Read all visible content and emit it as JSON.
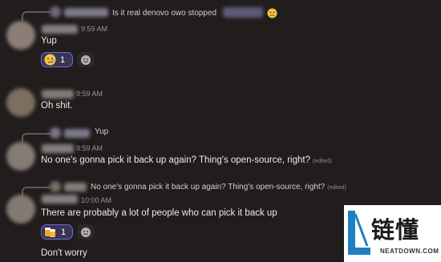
{
  "messages": [
    {
      "reply_preview": "Is it real denovo owo stopped",
      "time": "9:59 AM",
      "text": "Yup",
      "reactions": [
        {
          "emoji": "crying-face",
          "count": "1"
        }
      ]
    },
    {
      "time": "9:59 AM",
      "text": "Oh shit."
    },
    {
      "reply_preview": "Yup",
      "time": "9:59 AM",
      "text": "No one's gonna pick it back up again? Thing's open-source, right?",
      "edited": "(edited)"
    },
    {
      "reply_preview": "No one's gonna pick it back up again? Thing's open-source, right?",
      "reply_edited": "(edited)",
      "time": "10:00 AM",
      "text": "There are probably a lot of people who can pick it back up",
      "reactions": [
        {
          "emoji": "beer-mugs",
          "count": "1"
        }
      ]
    },
    {
      "text": "Don't worry"
    }
  ],
  "colors": {
    "background": "#211d1d",
    "reaction_border": "#6b6bd6",
    "reaction_bg": "#3a3552"
  },
  "watermark": {
    "logo_cn": "链懂",
    "logo_en": "NEATDOWN.COM"
  }
}
